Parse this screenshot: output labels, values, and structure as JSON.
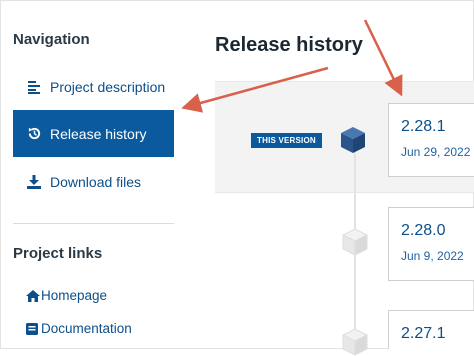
{
  "sidebar": {
    "heading": "Navigation",
    "items": [
      {
        "label": "Project description",
        "icon": "align-left-icon"
      },
      {
        "label": "Release history",
        "icon": "history-icon",
        "active": true
      },
      {
        "label": "Download files",
        "icon": "download-icon"
      }
    ],
    "links_heading": "Project links",
    "links": [
      {
        "label": "Homepage",
        "icon": "home-icon"
      },
      {
        "label": "Documentation",
        "icon": "book-icon"
      }
    ]
  },
  "annotation": {
    "title": "Release history",
    "arrow_color": "#d9604a"
  },
  "main": {
    "current_badge": "THIS VERSION",
    "releases": [
      {
        "version": "2.28.1",
        "date": "Jun 29, 2022"
      },
      {
        "version": "2.28.0",
        "date": "Jun 9, 2022"
      },
      {
        "version": "2.27.1",
        "date": ""
      }
    ]
  },
  "colors": {
    "accent": "#0b5a9d",
    "link": "#0c4f8a",
    "cube_current": "#2f5b93"
  }
}
